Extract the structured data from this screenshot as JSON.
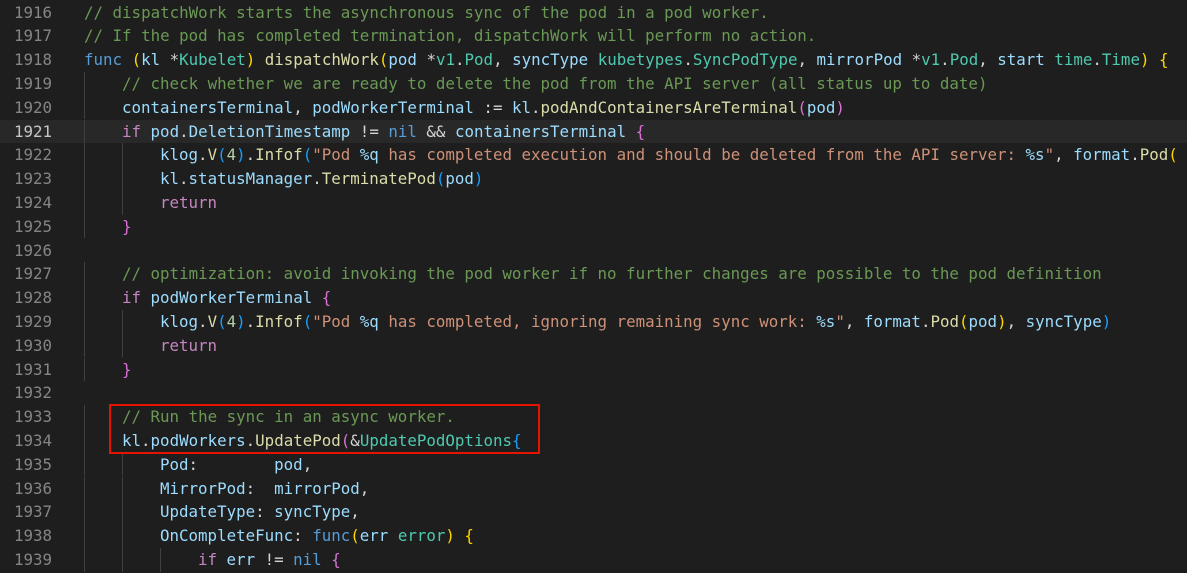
{
  "editor": {
    "lines": [
      {
        "num": "1916",
        "current": false,
        "indent": 0,
        "tokens": [
          {
            "t": "// dispatchWork starts the asynchronous sync of the pod in a pod worker.",
            "c": "c"
          }
        ]
      },
      {
        "num": "1917",
        "current": false,
        "indent": 0,
        "tokens": [
          {
            "t": "// If the pod has completed termination, dispatchWork will perform no action.",
            "c": "c"
          }
        ]
      },
      {
        "num": "1918",
        "current": false,
        "indent": 0,
        "tokens": [
          {
            "t": "func",
            "c": "k"
          },
          {
            "t": " ",
            "c": "p"
          },
          {
            "t": "(",
            "c": "b1"
          },
          {
            "t": "kl",
            "c": "v"
          },
          {
            "t": " *",
            "c": "p"
          },
          {
            "t": "Kubelet",
            "c": "t"
          },
          {
            "t": ")",
            "c": "b1"
          },
          {
            "t": " ",
            "c": "p"
          },
          {
            "t": "dispatchWork",
            "c": "f"
          },
          {
            "t": "(",
            "c": "b1"
          },
          {
            "t": "pod",
            "c": "v"
          },
          {
            "t": " *",
            "c": "p"
          },
          {
            "t": "v1",
            "c": "t"
          },
          {
            "t": ".",
            "c": "p"
          },
          {
            "t": "Pod",
            "c": "t"
          },
          {
            "t": ", ",
            "c": "p"
          },
          {
            "t": "syncType",
            "c": "v"
          },
          {
            "t": " ",
            "c": "p"
          },
          {
            "t": "kubetypes",
            "c": "t"
          },
          {
            "t": ".",
            "c": "p"
          },
          {
            "t": "SyncPodType",
            "c": "t"
          },
          {
            "t": ", ",
            "c": "p"
          },
          {
            "t": "mirrorPod",
            "c": "v"
          },
          {
            "t": " *",
            "c": "p"
          },
          {
            "t": "v1",
            "c": "t"
          },
          {
            "t": ".",
            "c": "p"
          },
          {
            "t": "Pod",
            "c": "t"
          },
          {
            "t": ", ",
            "c": "p"
          },
          {
            "t": "start",
            "c": "v"
          },
          {
            "t": " ",
            "c": "p"
          },
          {
            "t": "time",
            "c": "t"
          },
          {
            "t": ".",
            "c": "p"
          },
          {
            "t": "Time",
            "c": "t"
          },
          {
            "t": ")",
            "c": "b1"
          },
          {
            "t": " ",
            "c": "p"
          },
          {
            "t": "{",
            "c": "b1"
          }
        ]
      },
      {
        "num": "1919",
        "current": false,
        "indent": 1,
        "tokens": [
          {
            "t": "// check whether we are ready to delete the pod from the API server (all status up to date)",
            "c": "c"
          }
        ]
      },
      {
        "num": "1920",
        "current": false,
        "indent": 1,
        "tokens": [
          {
            "t": "containersTerminal",
            "c": "v"
          },
          {
            "t": ", ",
            "c": "p"
          },
          {
            "t": "podWorkerTerminal",
            "c": "v"
          },
          {
            "t": " := ",
            "c": "p"
          },
          {
            "t": "kl",
            "c": "v"
          },
          {
            "t": ".",
            "c": "p"
          },
          {
            "t": "podAndContainersAreTerminal",
            "c": "f"
          },
          {
            "t": "(",
            "c": "b2"
          },
          {
            "t": "pod",
            "c": "v"
          },
          {
            "t": ")",
            "c": "b2"
          }
        ]
      },
      {
        "num": "1921",
        "current": true,
        "indent": 1,
        "tokens": [
          {
            "t": "if",
            "c": "ctl"
          },
          {
            "t": " ",
            "c": "p"
          },
          {
            "t": "pod",
            "c": "v"
          },
          {
            "t": ".",
            "c": "p"
          },
          {
            "t": "DeletionTimestamp",
            "c": "v"
          },
          {
            "t": " != ",
            "c": "p"
          },
          {
            "t": "nil",
            "c": "k"
          },
          {
            "t": " && ",
            "c": "p"
          },
          {
            "t": "containersTerminal",
            "c": "v"
          },
          {
            "t": " ",
            "c": "p"
          },
          {
            "t": "{",
            "c": "b2"
          }
        ]
      },
      {
        "num": "1922",
        "current": false,
        "indent": 2,
        "tokens": [
          {
            "t": "klog",
            "c": "v"
          },
          {
            "t": ".",
            "c": "p"
          },
          {
            "t": "V",
            "c": "f"
          },
          {
            "t": "(",
            "c": "b3"
          },
          {
            "t": "4",
            "c": "n"
          },
          {
            "t": ")",
            "c": "b3"
          },
          {
            "t": ".",
            "c": "p"
          },
          {
            "t": "Infof",
            "c": "f"
          },
          {
            "t": "(",
            "c": "b3"
          },
          {
            "t": "\"Pod ",
            "c": "s"
          },
          {
            "t": "%q",
            "c": "fmt"
          },
          {
            "t": " has completed execution and should be deleted from the API server: ",
            "c": "s"
          },
          {
            "t": "%s",
            "c": "fmt"
          },
          {
            "t": "\"",
            "c": "s"
          },
          {
            "t": ", ",
            "c": "p"
          },
          {
            "t": "format",
            "c": "v"
          },
          {
            "t": ".",
            "c": "p"
          },
          {
            "t": "Pod",
            "c": "f"
          },
          {
            "t": "(",
            "c": "b1"
          }
        ]
      },
      {
        "num": "1923",
        "current": false,
        "indent": 2,
        "tokens": [
          {
            "t": "kl",
            "c": "v"
          },
          {
            "t": ".",
            "c": "p"
          },
          {
            "t": "statusManager",
            "c": "v"
          },
          {
            "t": ".",
            "c": "p"
          },
          {
            "t": "TerminatePod",
            "c": "f"
          },
          {
            "t": "(",
            "c": "b3"
          },
          {
            "t": "pod",
            "c": "v"
          },
          {
            "t": ")",
            "c": "b3"
          }
        ]
      },
      {
        "num": "1924",
        "current": false,
        "indent": 2,
        "tokens": [
          {
            "t": "return",
            "c": "ctl"
          }
        ]
      },
      {
        "num": "1925",
        "current": false,
        "indent": 1,
        "tokens": [
          {
            "t": "}",
            "c": "b2"
          }
        ]
      },
      {
        "num": "1926",
        "current": false,
        "indent": 0,
        "tokens": []
      },
      {
        "num": "1927",
        "current": false,
        "indent": 1,
        "tokens": [
          {
            "t": "// optimization: avoid invoking the pod worker if no further changes are possible to the pod definition",
            "c": "c"
          }
        ]
      },
      {
        "num": "1928",
        "current": false,
        "indent": 1,
        "tokens": [
          {
            "t": "if",
            "c": "ctl"
          },
          {
            "t": " ",
            "c": "p"
          },
          {
            "t": "podWorkerTerminal",
            "c": "v"
          },
          {
            "t": " ",
            "c": "p"
          },
          {
            "t": "{",
            "c": "b2"
          }
        ]
      },
      {
        "num": "1929",
        "current": false,
        "indent": 2,
        "tokens": [
          {
            "t": "klog",
            "c": "v"
          },
          {
            "t": ".",
            "c": "p"
          },
          {
            "t": "V",
            "c": "f"
          },
          {
            "t": "(",
            "c": "b3"
          },
          {
            "t": "4",
            "c": "n"
          },
          {
            "t": ")",
            "c": "b3"
          },
          {
            "t": ".",
            "c": "p"
          },
          {
            "t": "Infof",
            "c": "f"
          },
          {
            "t": "(",
            "c": "b3"
          },
          {
            "t": "\"Pod ",
            "c": "s"
          },
          {
            "t": "%q",
            "c": "fmt"
          },
          {
            "t": " has completed, ignoring remaining sync work: ",
            "c": "s"
          },
          {
            "t": "%s",
            "c": "fmt"
          },
          {
            "t": "\"",
            "c": "s"
          },
          {
            "t": ", ",
            "c": "p"
          },
          {
            "t": "format",
            "c": "v"
          },
          {
            "t": ".",
            "c": "p"
          },
          {
            "t": "Pod",
            "c": "f"
          },
          {
            "t": "(",
            "c": "b1"
          },
          {
            "t": "pod",
            "c": "v"
          },
          {
            "t": ")",
            "c": "b1"
          },
          {
            "t": ", ",
            "c": "p"
          },
          {
            "t": "syncType",
            "c": "v"
          },
          {
            "t": ")",
            "c": "b3"
          }
        ]
      },
      {
        "num": "1930",
        "current": false,
        "indent": 2,
        "tokens": [
          {
            "t": "return",
            "c": "ctl"
          }
        ]
      },
      {
        "num": "1931",
        "current": false,
        "indent": 1,
        "tokens": [
          {
            "t": "}",
            "c": "b2"
          }
        ]
      },
      {
        "num": "1932",
        "current": false,
        "indent": 0,
        "tokens": []
      },
      {
        "num": "1933",
        "current": false,
        "indent": 1,
        "tokens": [
          {
            "t": "// Run the sync in an async worker.",
            "c": "c"
          }
        ]
      },
      {
        "num": "1934",
        "current": false,
        "indent": 1,
        "tokens": [
          {
            "t": "kl",
            "c": "v"
          },
          {
            "t": ".",
            "c": "p"
          },
          {
            "t": "podWorkers",
            "c": "v"
          },
          {
            "t": ".",
            "c": "p"
          },
          {
            "t": "UpdatePod",
            "c": "f"
          },
          {
            "t": "(",
            "c": "b2"
          },
          {
            "t": "&",
            "c": "p"
          },
          {
            "t": "UpdatePodOptions",
            "c": "t"
          },
          {
            "t": "{",
            "c": "b3"
          }
        ]
      },
      {
        "num": "1935",
        "current": false,
        "indent": 2,
        "tokens": [
          {
            "t": "Pod",
            "c": "v"
          },
          {
            "t": ":        ",
            "c": "p"
          },
          {
            "t": "pod",
            "c": "v"
          },
          {
            "t": ",",
            "c": "p"
          }
        ]
      },
      {
        "num": "1936",
        "current": false,
        "indent": 2,
        "tokens": [
          {
            "t": "MirrorPod",
            "c": "v"
          },
          {
            "t": ":  ",
            "c": "p"
          },
          {
            "t": "mirrorPod",
            "c": "v"
          },
          {
            "t": ",",
            "c": "p"
          }
        ]
      },
      {
        "num": "1937",
        "current": false,
        "indent": 2,
        "tokens": [
          {
            "t": "UpdateType",
            "c": "v"
          },
          {
            "t": ": ",
            "c": "p"
          },
          {
            "t": "syncType",
            "c": "v"
          },
          {
            "t": ",",
            "c": "p"
          }
        ]
      },
      {
        "num": "1938",
        "current": false,
        "indent": 2,
        "tokens": [
          {
            "t": "OnCompleteFunc",
            "c": "v"
          },
          {
            "t": ": ",
            "c": "p"
          },
          {
            "t": "func",
            "c": "k"
          },
          {
            "t": "(",
            "c": "b1"
          },
          {
            "t": "err",
            "c": "v"
          },
          {
            "t": " ",
            "c": "p"
          },
          {
            "t": "error",
            "c": "t"
          },
          {
            "t": ")",
            "c": "b1"
          },
          {
            "t": " ",
            "c": "p"
          },
          {
            "t": "{",
            "c": "b1"
          }
        ]
      },
      {
        "num": "1939",
        "current": false,
        "indent": 3,
        "tokens": [
          {
            "t": "if",
            "c": "ctl"
          },
          {
            "t": " ",
            "c": "p"
          },
          {
            "t": "err",
            "c": "v"
          },
          {
            "t": " != ",
            "c": "p"
          },
          {
            "t": "nil",
            "c": "k"
          },
          {
            "t": " ",
            "c": "p"
          },
          {
            "t": "{",
            "c": "b2"
          }
        ]
      }
    ]
  }
}
